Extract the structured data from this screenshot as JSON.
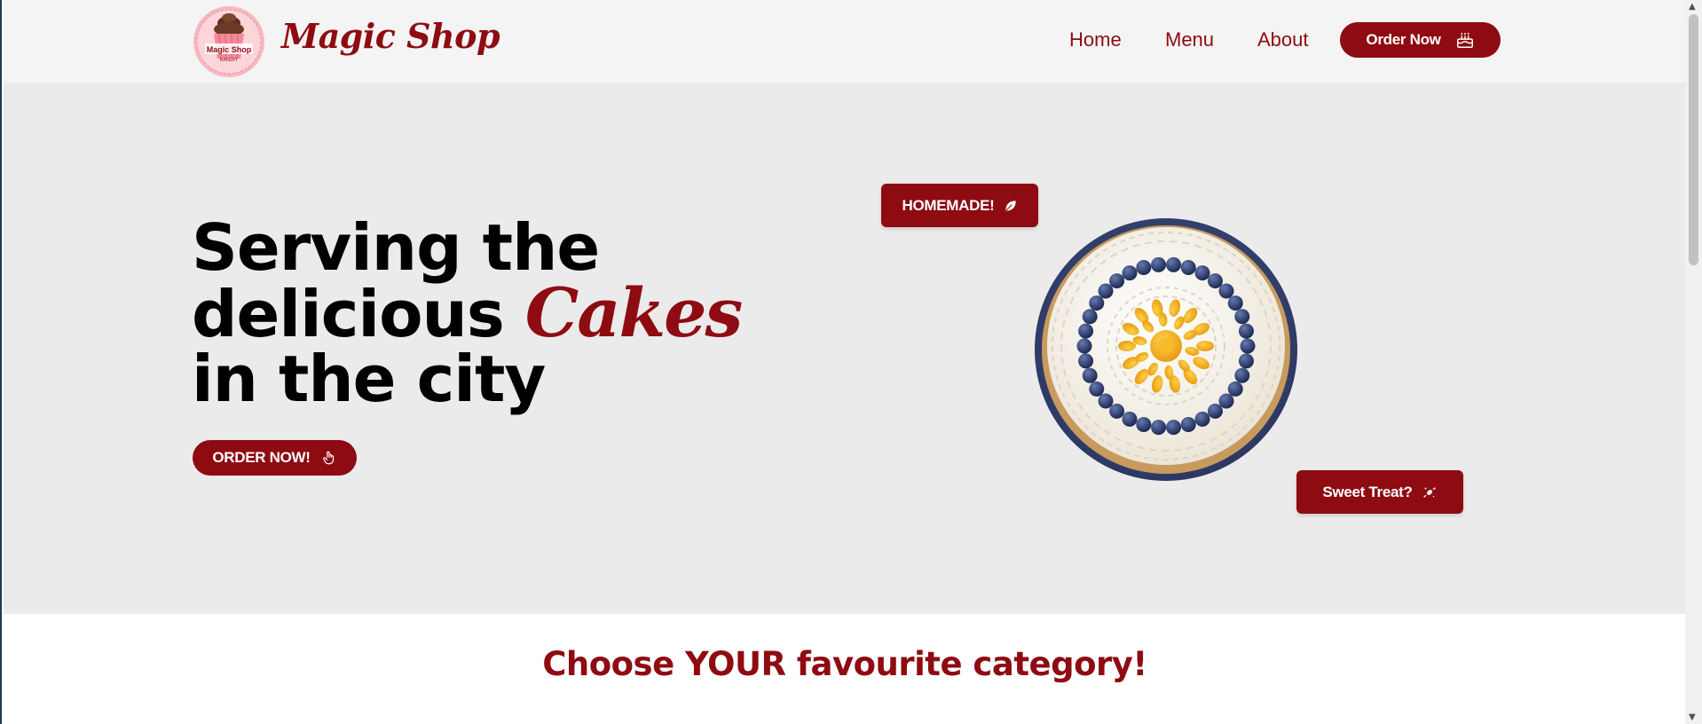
{
  "header": {
    "brand": "Magic Shop",
    "logo_text": "Magic Shop",
    "logo_subtext": "BAKERY",
    "nav": {
      "home": "Home",
      "menu": "Menu",
      "about": "About"
    },
    "order_button": {
      "label": "Order Now",
      "icon": "cake-icon"
    }
  },
  "hero": {
    "title_part1": "Serving the delicious ",
    "title_accent": "Cakes",
    "title_part2": " in the city",
    "cta": {
      "label": "ORDER NOW!",
      "icon": "hand-pointer-icon"
    },
    "tag_homemade": {
      "label": "HOMEMADE!",
      "icon": "leaf-icon"
    },
    "tag_sweet": {
      "label": "Sweet Treat?",
      "icon": "candy-icon"
    },
    "image": "blueberry-cream-cake"
  },
  "categories": {
    "title": "Choose YOUR favourite category!"
  },
  "colors": {
    "accent": "#8e0b12",
    "header_bg": "#f4f4f4",
    "hero_bg": "#ebebeb"
  }
}
